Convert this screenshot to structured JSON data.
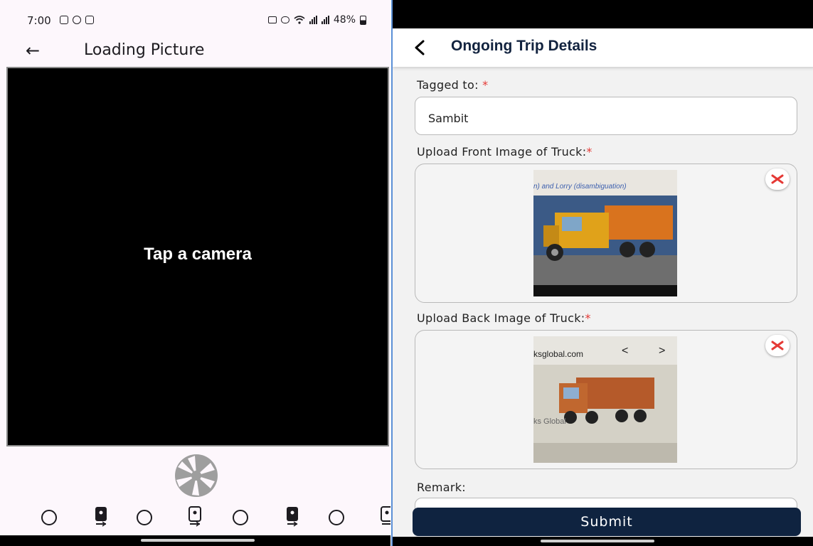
{
  "left": {
    "status": {
      "time": "7:00",
      "battery": "48%"
    },
    "title": "Loading Picture",
    "preview_message": "Tap a camera"
  },
  "right": {
    "title": "Ongoing Trip Details",
    "form": {
      "tagged_label": "Tagged to:",
      "tagged_value": "Sambit",
      "front_label": "Upload Front Image of Truck:",
      "back_label": "Upload Back Image of Truck:",
      "remark_label": "Remark:",
      "required_mark": "*",
      "front_photo_caption": "n) and Lorry (disambiguation)",
      "back_photo_caption_top": "ksglobal.com",
      "back_photo_caption_bottom": "ks Global",
      "submit_label": "Submit"
    }
  },
  "icons": {
    "left_status": [
      "gallery-icon",
      "whatsapp-icon",
      "calendar-icon",
      "alarm-icon",
      "mute-icon",
      "wifi-icon",
      "signal-icon",
      "battery-icon"
    ],
    "camera_selector": [
      "camera-circle-icon",
      "camera-phone-icon"
    ],
    "close": "close-icon"
  },
  "colors": {
    "header_navy": "#12233f",
    "submit_bg": "#0f2340",
    "required": "#e53935",
    "close_red": "#e53935"
  }
}
